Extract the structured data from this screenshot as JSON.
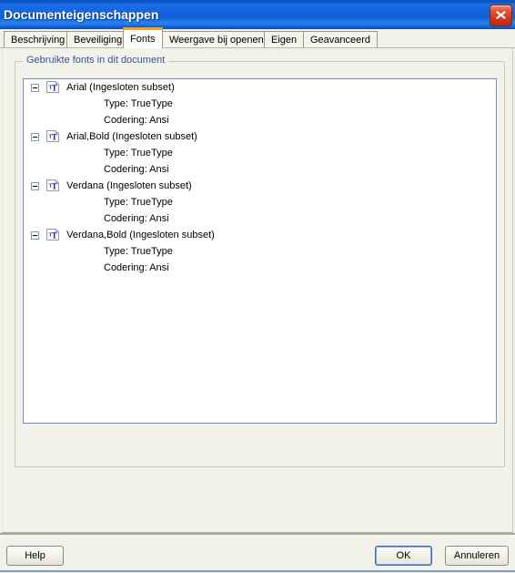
{
  "window": {
    "title": "Documenteigenschappen",
    "close_icon": "close-icon"
  },
  "tabs": [
    {
      "label": "Beschrijving",
      "active": false
    },
    {
      "label": "Beveiliging",
      "active": false
    },
    {
      "label": "Fonts",
      "active": true
    },
    {
      "label": "Weergave bij openen",
      "active": false
    },
    {
      "label": "Eigen",
      "active": false
    },
    {
      "label": "Geavanceerd",
      "active": false
    }
  ],
  "groupbox": {
    "label": "Gebruikte fonts in dit document"
  },
  "fonts": [
    {
      "name": "Arial (Ingesloten subset)",
      "icon": "truetype-font-icon",
      "expander": "collapse-minus-icon",
      "type_line": "Type: TrueType",
      "encoding_line": "Codering: Ansi"
    },
    {
      "name": "Arial,Bold (Ingesloten subset)",
      "icon": "truetype-font-icon",
      "expander": "collapse-minus-icon",
      "type_line": "Type: TrueType",
      "encoding_line": "Codering: Ansi"
    },
    {
      "name": "Verdana (Ingesloten subset)",
      "icon": "truetype-font-icon",
      "expander": "collapse-minus-icon",
      "type_line": "Type: TrueType",
      "encoding_line": "Codering: Ansi"
    },
    {
      "name": "Verdana,Bold (Ingesloten subset)",
      "icon": "truetype-font-icon",
      "expander": "collapse-minus-icon",
      "type_line": "Type: TrueType",
      "encoding_line": "Codering: Ansi"
    }
  ],
  "footer": {
    "help_label": "Help",
    "ok_label": "OK",
    "cancel_label": "Annuleren"
  },
  "colors": {
    "titlebar_blue": "#1363dd",
    "close_red": "#cf3516",
    "active_tab_accent": "#f5a320",
    "groupbox_label_blue": "#35539e",
    "tree_border_blue": "#6e8db5",
    "dialog_bg": "#f2f1ea",
    "default_button_focus": "#3c6ab0"
  }
}
